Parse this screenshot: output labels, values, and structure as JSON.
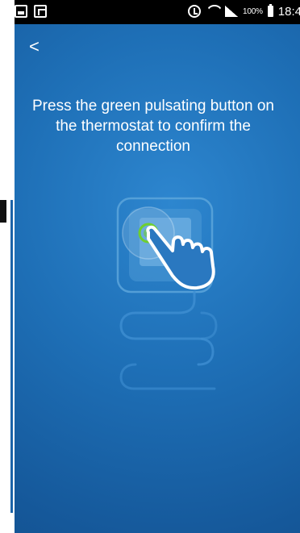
{
  "status_bar": {
    "left_icons": [
      "image-notification-icon",
      "cast-icon"
    ],
    "right_icons": [
      "alarm-icon",
      "wifi-icon",
      "signal-icon"
    ],
    "battery": "100%",
    "time": "18:4"
  },
  "header": {
    "back_label": "<"
  },
  "content": {
    "instruction": "Press the green pulsating button on\nthe thermostat to confirm the\nconnection"
  },
  "illustration": {
    "icons": [
      "thermostat-icon",
      "pointing-hand-icon",
      "cable-icon"
    ],
    "colors": {
      "background_top": "#2d86cf",
      "background_bottom": "#134f8c",
      "outline": "#5fa7dc",
      "button_green": "#6fcf2f",
      "hand": "#ffffff"
    }
  }
}
